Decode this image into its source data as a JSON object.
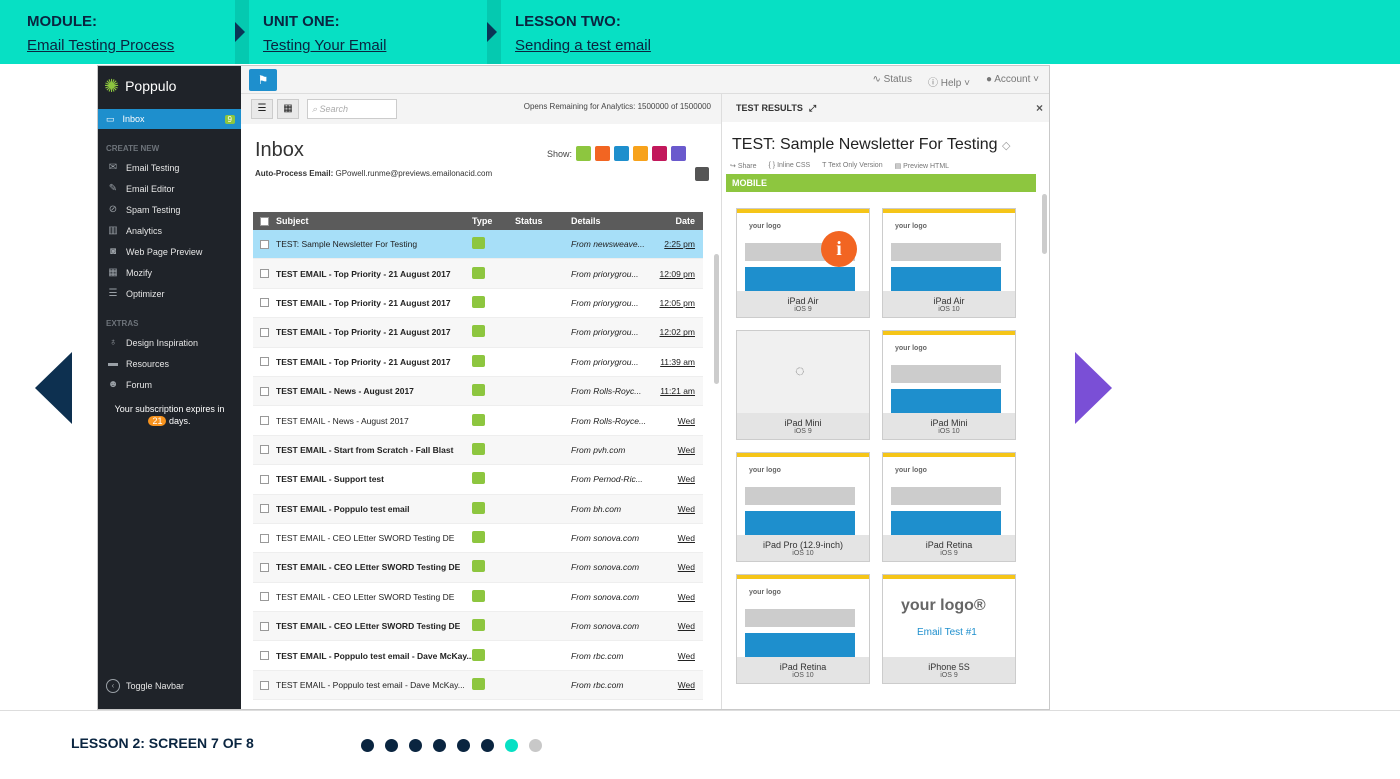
{
  "header": {
    "module": {
      "label": "MODULE:",
      "link": "Email Testing Process"
    },
    "unit": {
      "label": "UNIT ONE:",
      "link": "Testing Your Email"
    },
    "lesson": {
      "label": "LESSON TWO:",
      "link": "Sending a test email"
    }
  },
  "app": {
    "brand": "Poppulo",
    "sidebar": {
      "inbox": {
        "label": "Inbox",
        "badge": "9"
      },
      "create_new_title": "CREATE NEW",
      "create_items": [
        "Email Testing",
        "Email Editor",
        "Spam Testing",
        "Analytics",
        "Web Page Preview",
        "Mozify",
        "Optimizer"
      ],
      "extras_title": "EXTRAS",
      "extras_items": [
        "Design Inspiration",
        "Resources",
        "Forum"
      ],
      "expire_text_1": "Your subscription expires in",
      "expire_days": "21",
      "expire_text_2": "days.",
      "toggle": "Toggle Navbar"
    },
    "topbar": {
      "status": "Status",
      "help": "Help",
      "account": "Account"
    },
    "inbox": {
      "search_placeholder": "Search",
      "opens": "Opens Remaining for Analytics: 1500000 of 1500000",
      "title": "Inbox",
      "show_label": "Show:",
      "autoprocess_label": "Auto-Process Email:",
      "autoprocess_value": "GPowell.runme@previews.emailonacid.com",
      "columns": [
        "Subject",
        "Type",
        "Status",
        "Details",
        "Date"
      ],
      "rows": [
        {
          "subject": "TEST: Sample Newsletter For Testing",
          "details": "From newsweave...",
          "date": "2:25 pm",
          "bold": false,
          "selected": true
        },
        {
          "subject": "TEST EMAIL - Top Priority - 21 August 2017",
          "details": "From priorygrou...",
          "date": "12:09 pm",
          "bold": true,
          "selected": false
        },
        {
          "subject": "TEST EMAIL - Top Priority - 21 August 2017",
          "details": "From priorygrou...",
          "date": "12:05 pm",
          "bold": true,
          "selected": false
        },
        {
          "subject": "TEST EMAIL - Top Priority - 21 August 2017",
          "details": "From priorygrou...",
          "date": "12:02 pm",
          "bold": true,
          "selected": false
        },
        {
          "subject": "TEST EMAIL - Top Priority - 21 August 2017",
          "details": "From priorygrou...",
          "date": "11:39 am",
          "bold": true,
          "selected": false
        },
        {
          "subject": "TEST EMAIL - News - August 2017",
          "details": "From Rolls-Royc...",
          "date": "11:21 am",
          "bold": true,
          "selected": false
        },
        {
          "subject": "TEST EMAIL - News - August 2017",
          "details": "From Rolls-Royce...",
          "date": "Wed",
          "bold": false,
          "selected": false
        },
        {
          "subject": "TEST EMAIL - Start from Scratch - Fall Blast",
          "details": "From pvh.com",
          "date": "Wed",
          "bold": true,
          "selected": false
        },
        {
          "subject": "TEST EMAIL - Support test",
          "details": "From Pernod-Ric...",
          "date": "Wed",
          "bold": true,
          "selected": false
        },
        {
          "subject": "TEST EMAIL - Poppulo test email",
          "details": "From bh.com",
          "date": "Wed",
          "bold": true,
          "selected": false
        },
        {
          "subject": "TEST EMAIL - CEO LEtter SWORD Testing DE",
          "details": "From sonova.com",
          "date": "Wed",
          "bold": false,
          "selected": false
        },
        {
          "subject": "TEST EMAIL - CEO LEtter SWORD Testing DE",
          "details": "From sonova.com",
          "date": "Wed",
          "bold": true,
          "selected": false
        },
        {
          "subject": "TEST EMAIL - CEO LEtter SWORD Testing DE",
          "details": "From sonova.com",
          "date": "Wed",
          "bold": false,
          "selected": false
        },
        {
          "subject": "TEST EMAIL - CEO LEtter SWORD Testing DE",
          "details": "From sonova.com",
          "date": "Wed",
          "bold": true,
          "selected": false
        },
        {
          "subject": "TEST EMAIL - Poppulo test email - Dave McKay...",
          "details": "From rbc.com",
          "date": "Wed",
          "bold": true,
          "selected": false
        },
        {
          "subject": "TEST EMAIL - Poppulo test email - Dave McKay...",
          "details": "From rbc.com",
          "date": "Wed",
          "bold": false,
          "selected": false
        }
      ]
    },
    "results": {
      "header": "TEST RESULTS",
      "title": "TEST: Sample Newsletter For Testing",
      "actions": [
        "Share",
        "Inline CSS",
        "Text Only Version",
        "Preview HTML"
      ],
      "section": "MOBILE",
      "devices": [
        {
          "name": "iPad Air",
          "os": "iOS 9",
          "thumb": "email",
          "info": true
        },
        {
          "name": "iPad Air",
          "os": "iOS 10",
          "thumb": "email",
          "info": false
        },
        {
          "name": "iPad Mini",
          "os": "iOS 9",
          "thumb": "loading",
          "info": false
        },
        {
          "name": "iPad Mini",
          "os": "iOS 10",
          "thumb": "email",
          "info": false
        },
        {
          "name": "iPad Pro (12.9-inch)",
          "os": "iOS 10",
          "thumb": "email",
          "info": false
        },
        {
          "name": "iPad Retina",
          "os": "iOS 9",
          "thumb": "email",
          "info": false
        },
        {
          "name": "iPad Retina",
          "os": "iOS 10",
          "thumb": "email",
          "info": false
        },
        {
          "name": "iPhone 5S",
          "os": "iOS 9",
          "thumb": "big",
          "info": false
        }
      ],
      "thumb_logo": "your logo",
      "big_logo": "your logo®",
      "big_link": "Email Test #1"
    }
  },
  "footer": {
    "progress": "LESSON 2: SCREEN 7 OF 8",
    "total_screens": 8,
    "current_screen": 7
  },
  "colors": {
    "accent": "#07e0c4",
    "navy": "#0a2540",
    "purple": "#7a4fd6",
    "app_blue": "#1e8fcd",
    "app_green": "#8dc63f"
  }
}
